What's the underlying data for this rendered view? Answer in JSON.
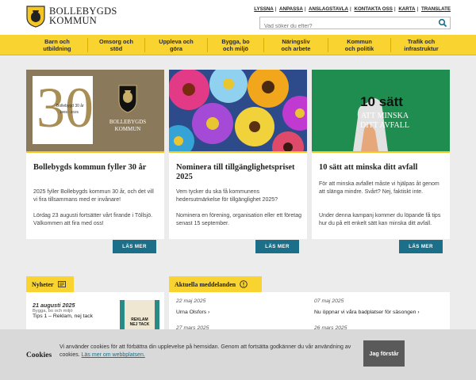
{
  "header": {
    "logo_line1": "BOLLEBYGDS",
    "logo_line2": "KOMMUN",
    "toplinks": [
      "LYSSNA",
      "ANPASSA",
      "ANSLAGSTAVLA",
      "KONTAKTA OSS",
      "KARTA",
      "TRANSLATE"
    ],
    "search_placeholder": "Vad söker du efter?"
  },
  "nav": [
    {
      "line1": "Barn och",
      "line2": "utbildning"
    },
    {
      "line1": "Omsorg och",
      "line2": "stöd"
    },
    {
      "line1": "Uppleva och",
      "line2": "göra"
    },
    {
      "line1": "Bygga, bo",
      "line2": "och miljö"
    },
    {
      "line1": "Näringsliv",
      "line2": "och arbete"
    },
    {
      "line1": "Kommun",
      "line2": "och politik"
    },
    {
      "line1": "Trafik och",
      "line2": "infrastruktur"
    }
  ],
  "cards": [
    {
      "title": "Bollebygds kommun fyller 30 år",
      "p1": "2025 fyller Bollebygds kommun 30 år, och det vill vi fira tillsammans med er invånare!",
      "p2": "Lördag 23 augusti fortsätter vårt firande i Töllsjö. Välkommen att fira med oss!",
      "button": "LÄS MER",
      "image_text": {
        "anniv_line1": "Bollebygd 30 år",
        "anniv_line2": "1995 - 2025",
        "brand1": "BOLLEBYGDS",
        "brand2": "KOMMUN",
        "numeral": "30"
      }
    },
    {
      "title": "Nominera till tillgänglighetspriset 2025",
      "p1": "Vem tycker du ska få kommunens hedersutmärkelse för tillgänglighet 2025?",
      "p2": "Nominera en förening, organisation eller ett företag senast 15 september.",
      "button": "LÄS MER"
    },
    {
      "title": "10 sätt att minska ditt avfall",
      "p1": "För att minska avfallet måste vi hjälpas åt genom att slänga mindre. Svårt? Nej, faktiskt inte.",
      "p2": "Under denna kampanj kommer du löpande få tips hur du på ett enkelt sätt kan minska ditt avfall.",
      "button": "LÄS MER",
      "image_text": {
        "line1": "10 sätt",
        "line2": "ATT MINSKA",
        "line3": "DITT AVFALL"
      }
    }
  ],
  "news": {
    "tab": "Nyheter",
    "items": [
      {
        "date": "21 augusti 2025",
        "category": "Bygga, bo och miljö",
        "title": "Tips 1 – Reklam, nej tack",
        "thumb_text1": "REKLAM",
        "thumb_text2": "NEJ TACK"
      }
    ]
  },
  "messages": {
    "tab": "Aktuella meddelanden",
    "items": [
      {
        "date": "22 maj 2025",
        "text": "Urna Olsfors"
      },
      {
        "date": "07 maj 2025",
        "text": "Nu öppnar vi våra badplatser för säsongen"
      },
      {
        "date": "27 mars 2025",
        "text": ""
      },
      {
        "date": "26 mars 2025",
        "text": ""
      }
    ]
  },
  "cookie": {
    "title": "Cookies",
    "text": "Vi använder cookies för att förbättra din upplevelse på hemsidan. Genom att fortsätta godkänner du vår användning av cookies.",
    "link": "Läs mer om webbplatsen.",
    "button": "Jag förstår"
  },
  "colors": {
    "brand_yellow": "#f9d330",
    "button_teal": "#1b6f88",
    "logo_gold": "#f3c623"
  }
}
